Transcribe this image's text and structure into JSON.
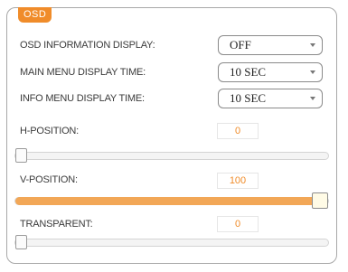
{
  "panel": {
    "title": "OSD"
  },
  "osd_info": {
    "label": "OSD INFORMATION DISPLAY:",
    "value": "OFF"
  },
  "main_menu_time": {
    "label": "MAIN MENU DISPLAY TIME:",
    "value": "10 SEC"
  },
  "info_menu_time": {
    "label": "INFO MENU DISPLAY TIME:",
    "value": "10 SEC"
  },
  "h_position": {
    "label": "H-POSITION:",
    "value": "0",
    "level_percent": 0
  },
  "v_position": {
    "label": "V-POSITION:",
    "value": "100",
    "level_percent": 100
  },
  "transparent": {
    "label": "TRANSPARENT:",
    "value": "0",
    "level_percent": 0
  },
  "colors": {
    "accent": "#f08c2a",
    "slider_fill": "#f2a757"
  }
}
